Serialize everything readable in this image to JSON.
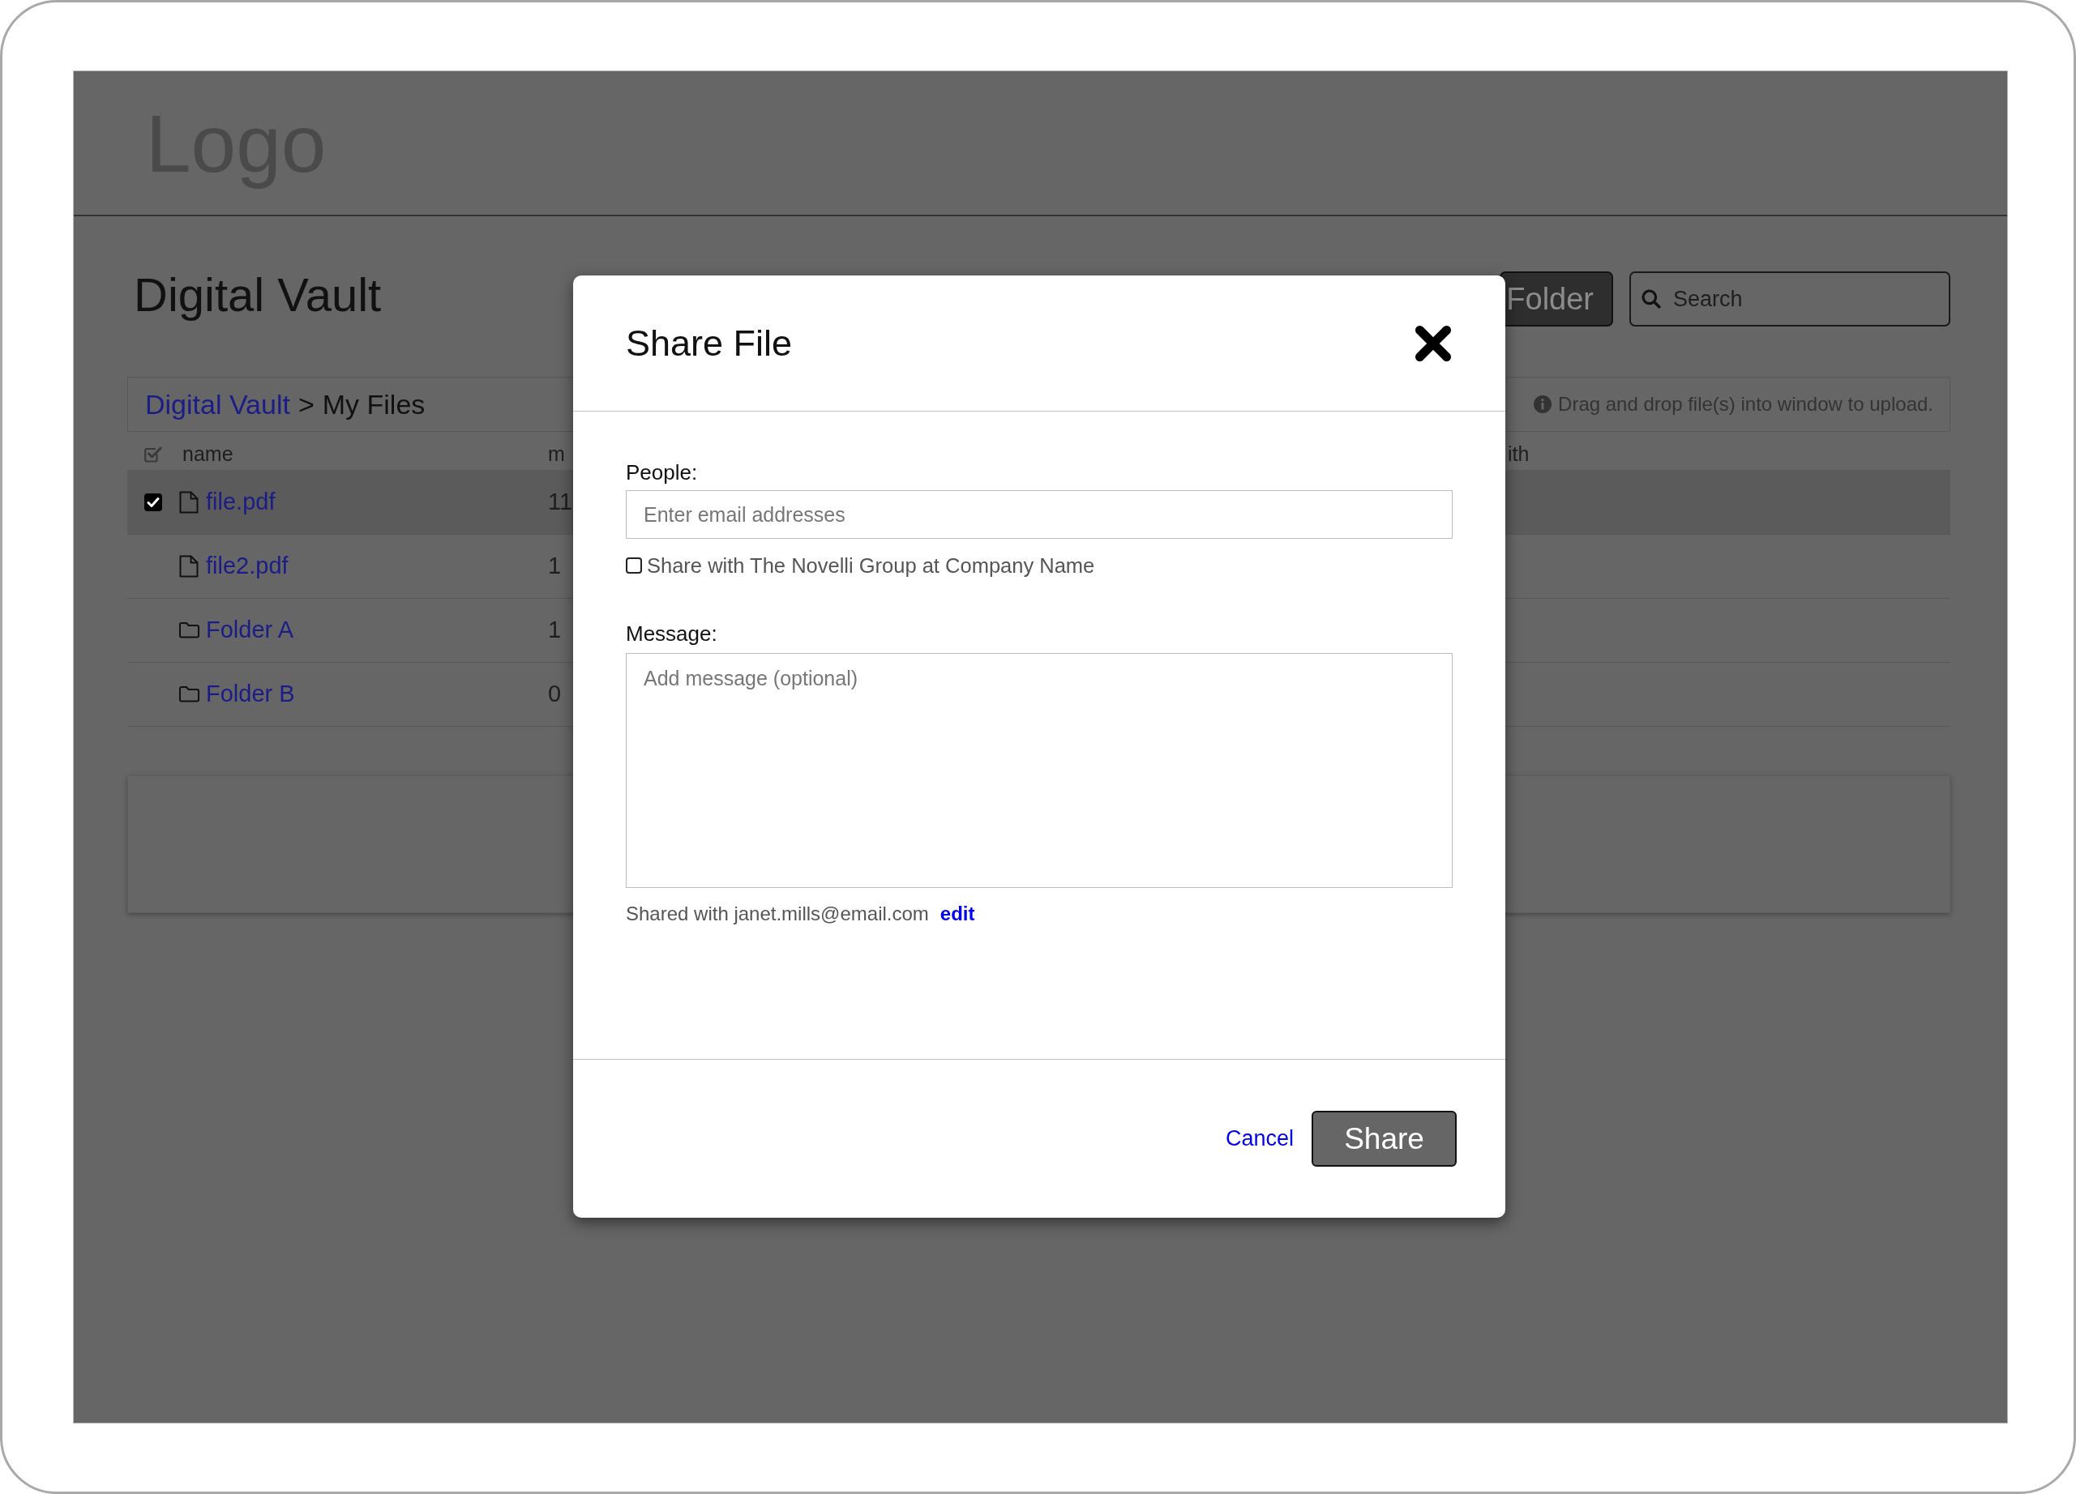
{
  "header": {
    "logo": "Logo"
  },
  "page": {
    "title": "Digital Vault"
  },
  "toolbar": {
    "buttons": [
      {
        "label": "Folder"
      }
    ],
    "search": {
      "placeholder": "Search"
    }
  },
  "breadcrumb": {
    "link": "Digital Vault",
    "separator": ">",
    "current": "My Files",
    "hint": "Drag and drop file(s) into window to upload."
  },
  "table": {
    "columns": [
      "name",
      "m",
      "ith"
    ],
    "rows": [
      {
        "kind": "file",
        "name": "file.pdf",
        "column_2": "11",
        "checked": true
      },
      {
        "kind": "file",
        "name": "file2.pdf",
        "column_2": "1",
        "checked": false
      },
      {
        "kind": "folder",
        "name": "Folder A",
        "column_2": "1",
        "checked": false
      },
      {
        "kind": "folder",
        "name": "Folder B",
        "column_2": "0",
        "checked": false
      }
    ]
  },
  "modal": {
    "title": "Share File",
    "people": {
      "label": "People:",
      "placeholder": "Enter email addresses"
    },
    "group_share": {
      "label": "Share with The Novelli Group at Company Name",
      "checked": false
    },
    "message": {
      "label": "Message:",
      "placeholder": "Add message (optional)"
    },
    "shared_with": {
      "text": "Shared with janet.mills@email.com",
      "link": "edit"
    },
    "cancel": "Cancel",
    "share": "Share"
  }
}
